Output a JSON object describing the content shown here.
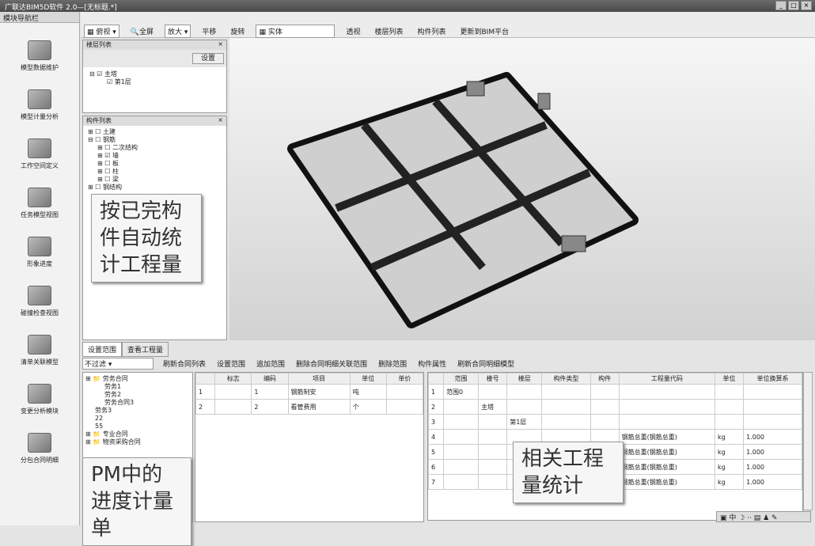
{
  "title": "广联达BIM5D软件 2.0—[无标题.*]",
  "nav": {
    "header": "模块导航栏",
    "items": [
      "模型数据维护",
      "模型计量分析",
      "工作空间定义",
      "任务模型视图",
      "形象进度",
      "碰撞检查视图",
      "清单关联模型",
      "变更分析模块",
      "分包合同明细"
    ]
  },
  "toolbar": {
    "view": "俯视",
    "fullscreen": "全屏",
    "zoom": "放大",
    "pan": "平移",
    "rotate": "旋转",
    "render": "实体",
    "transparent": "透视",
    "floor_list": "楼层列表",
    "component_list": "构件列表",
    "update": "更新到BIM平台"
  },
  "floor_panel": {
    "title": "楼层列表",
    "set": "设置",
    "tree": [
      "主塔",
      "第1层"
    ]
  },
  "component_panel": {
    "title": "构件列表",
    "tree": [
      "土建",
      "钢筋",
      "二次结构",
      "墙",
      "板",
      "柱",
      "梁",
      "钢结构"
    ]
  },
  "callouts": {
    "a": "按已完构件自动统计工程量",
    "b": "PM中的进度计量单",
    "c": "相关工程量统计"
  },
  "bottom": {
    "tabs": [
      "设置范围",
      "查看工程量"
    ],
    "filter": "不过滤",
    "actions": [
      "刷新合同列表",
      "设置范围",
      "追加范围",
      "删除合同明细关联范围",
      "删除范围",
      "构件属性",
      "刷新合同明细模型"
    ]
  },
  "contract_tree": [
    "劳务合同",
    "劳务1",
    "劳务2",
    "劳务合同3",
    "劳务3",
    "22",
    "55",
    "专业合同",
    "物资采购合同"
  ],
  "table1": {
    "headers": [
      "",
      "标志",
      "编码",
      "项目",
      "单位",
      "单价"
    ],
    "rows": [
      [
        "1",
        "",
        "1",
        "钢筋制安",
        "吨",
        ""
      ],
      [
        "2",
        "",
        "2",
        "看管费用",
        "个",
        ""
      ]
    ]
  },
  "table2": {
    "headers": [
      "",
      "范围",
      "楼号",
      "楼层",
      "构件类型",
      "构件",
      "工程量代码",
      "单位",
      "单位换算系"
    ],
    "rows": [
      [
        "1",
        "范围0",
        "",
        "",
        "",
        "",
        "",
        "",
        ""
      ],
      [
        "2",
        "",
        "主塔",
        "",
        "",
        "",
        "",
        "",
        ""
      ],
      [
        "3",
        "",
        "",
        "第1层",
        "",
        "",
        "",
        "",
        ""
      ],
      [
        "4",
        "",
        "",
        "",
        "",
        "",
        "钢筋总重(钢筋总重)",
        "kg",
        "1.000"
      ],
      [
        "5",
        "",
        "",
        "",
        "",
        "",
        "钢筋总重(钢筋总重)",
        "kg",
        "1.000"
      ],
      [
        "6",
        "",
        "",
        "",
        "",
        "",
        "钢筋总重(钢筋总重)",
        "kg",
        "1.000"
      ],
      [
        "7",
        "",
        "",
        "",
        "",
        "",
        "钢筋总重(钢筋总重)",
        "kg",
        "1.000"
      ]
    ]
  },
  "status": "中"
}
